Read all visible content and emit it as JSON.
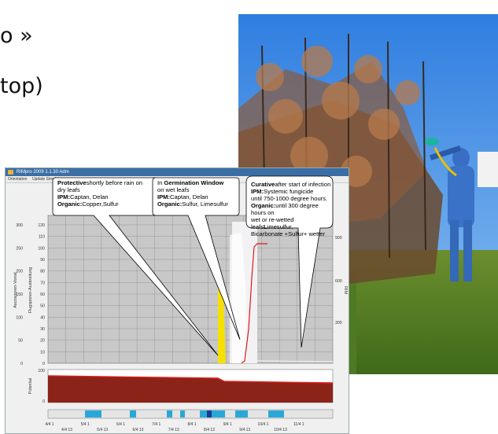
{
  "slide": {
    "line1": "o »",
    "line2": "top)"
  },
  "photo": {
    "icon": "orchard-photo"
  },
  "window": {
    "title": "RIMpro 2009 1.1.30 Adm",
    "menu": [
      "Orientation",
      "Update Simulat"
    ]
  },
  "bubbles": [
    {
      "id": "protective",
      "lines": [
        [
          {
            "b": true,
            "t": "Protective"
          },
          {
            "b": false,
            "t": "shortly before rain on"
          }
        ],
        [
          {
            "b": false,
            "t": "dry leafs"
          }
        ],
        [
          {
            "b": true,
            "t": "IPM:"
          },
          {
            "b": false,
            "t": "Captan, Delan"
          }
        ],
        [
          {
            "b": true,
            "t": "Organic:"
          },
          {
            "b": false,
            "t": "Copper,Sulfur"
          }
        ]
      ]
    },
    {
      "id": "germination",
      "lines": [
        [
          {
            "b": false,
            "t": "In "
          },
          {
            "b": true,
            "t": "Germination Window"
          }
        ],
        [
          {
            "b": false,
            "t": "on wet leafs"
          }
        ],
        [
          {
            "b": true,
            "t": "IPM:"
          },
          {
            "b": false,
            "t": "Captan, Delan"
          }
        ],
        [
          {
            "b": true,
            "t": "Organic:"
          },
          {
            "b": false,
            "t": "Sulfur, Limesulfur"
          }
        ]
      ]
    },
    {
      "id": "curative",
      "lines": [
        [
          {
            "b": true,
            "t": "Curative"
          },
          {
            "b": false,
            "t": "after start of infection"
          }
        ],
        [
          {
            "b": true,
            "t": "IPM:"
          },
          {
            "b": false,
            "t": "Systemic fungicide"
          }
        ],
        [
          {
            "b": false,
            "t": "until 750-1000 degree hours."
          }
        ],
        [
          {
            "b": true,
            "t": "Organic:"
          },
          {
            "b": false,
            "t": "until 300 degree hours on"
          }
        ],
        [
          {
            "b": false,
            "t": "wet or re-wetted leafs"
          },
          {
            "b": true,
            "t": "L"
          },
          {
            "b": false,
            "t": "imesulfur,"
          }
        ],
        [
          {
            "b": false,
            "t": "Bicarbonate +Sulfur+ wetter"
          }
        ]
      ]
    }
  ],
  "chart_data": [
    {
      "type": "area",
      "y_outer_ticks": [
        "300",
        "250",
        "200",
        "150",
        "100",
        "50",
        "0"
      ],
      "y_inner_ticks": [
        "120",
        "110",
        "100",
        "90",
        "80",
        "70",
        "60",
        "50",
        "40",
        "30",
        "20",
        "10",
        "0"
      ],
      "y_right_ticks": [
        "900",
        "600",
        "300"
      ],
      "y_outer_label": "Ascosporen-Vorrat",
      "y_inner_label": "Flugsporen-Ausbreitung",
      "y_right_label": "RIM",
      "grid": true,
      "colors": {
        "plot_bg": "#c8c8c8",
        "yellow": "#f5e000",
        "window": "#f2f2f4",
        "red": "#e01818"
      }
    },
    {
      "type": "area",
      "y_ticks": [
        "100",
        "0"
      ],
      "y_label": "Potential",
      "colors": {
        "fill": "#8b2318",
        "line": "#e02020"
      }
    },
    {
      "type": "table",
      "segments_color": "#29a8d8",
      "dark_segment_color": "#1a3a9a",
      "x_ticks_top": [
        "4/4 1",
        "5/4 1",
        "6/4 1",
        "7/4 1",
        "8/4 1",
        "9/4 1",
        "10/4 1",
        "11/4 1"
      ],
      "x_ticks_bottom": [
        "4/4 13",
        "5/4 13",
        "6/4 13",
        "7/4 13",
        "8/4 13",
        "9/4 13",
        "10/4 13"
      ]
    }
  ]
}
